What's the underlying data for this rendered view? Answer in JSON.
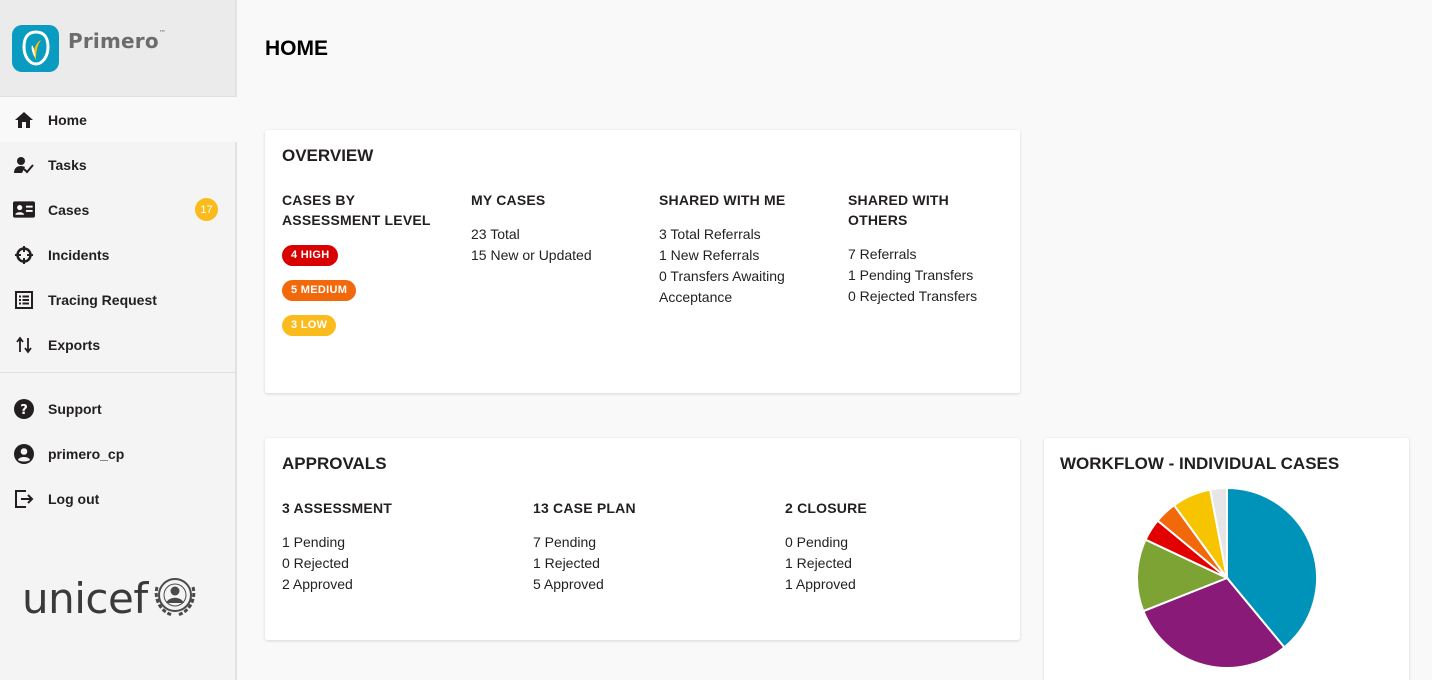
{
  "app": {
    "name": "Primero",
    "tm": "™",
    "partner_logo_text": "unicef"
  },
  "colors": {
    "brand": "#0a9bc0",
    "high": "#d90000",
    "medium": "#f2690b",
    "low": "#fbbb1c",
    "badge": "#fbbb1c"
  },
  "sidebar": {
    "items": [
      {
        "label": "Home",
        "icon": "home-icon",
        "active": true
      },
      {
        "label": "Tasks",
        "icon": "tasks-icon"
      },
      {
        "label": "Cases",
        "icon": "cases-icon",
        "badge": "17"
      },
      {
        "label": "Incidents",
        "icon": "incidents-icon"
      },
      {
        "label": "Tracing Request",
        "icon": "tracing-request-icon"
      },
      {
        "label": "Exports",
        "icon": "exports-icon"
      }
    ],
    "bottom_items": [
      {
        "label": "Support",
        "icon": "help-icon"
      },
      {
        "label": "primero_cp",
        "icon": "account-icon"
      },
      {
        "label": "Log out",
        "icon": "logout-icon"
      }
    ]
  },
  "page": {
    "title": "HOME"
  },
  "overview": {
    "title": "OVERVIEW",
    "assessment": {
      "heading_1": "CASES BY",
      "heading_2": "ASSESSMENT LEVEL",
      "high": "4 HIGH",
      "medium": "5 MEDIUM",
      "low": "3 LOW"
    },
    "my_cases": {
      "heading": "MY CASES",
      "lines": [
        "23 Total",
        "15 New or Updated"
      ]
    },
    "shared_with_me": {
      "heading": "SHARED WITH ME",
      "lines": [
        "3 Total Referrals",
        "1 New Referrals",
        "0 Transfers Awaiting",
        "Acceptance"
      ]
    },
    "shared_with_others": {
      "heading_1": "SHARED WITH",
      "heading_2": "OTHERS",
      "lines": [
        "7 Referrals",
        "1 Pending Transfers",
        "0 Rejected Transfers"
      ]
    }
  },
  "approvals": {
    "title": "APPROVALS",
    "assessment": {
      "heading": "3 ASSESSMENT",
      "lines": [
        "1 Pending",
        "0 Rejected",
        "2 Approved"
      ]
    },
    "case_plan": {
      "heading": "13 CASE PLAN",
      "lines": [
        "7 Pending",
        "1 Rejected",
        "5 Approved"
      ]
    },
    "closure": {
      "heading": "2 CLOSURE",
      "lines": [
        "0 Pending",
        "1 Rejected",
        "1 Approved"
      ]
    }
  },
  "workflow": {
    "title": "WORKFLOW - INDIVIDUAL CASES"
  },
  "chart_data": {
    "type": "pie",
    "values": [
      39,
      30,
      13,
      4,
      4,
      7,
      3
    ],
    "colors": [
      "#0093ba",
      "#8a1a78",
      "#7da335",
      "#e30000",
      "#f2690b",
      "#f7c400",
      "#e6e6e6"
    ]
  }
}
